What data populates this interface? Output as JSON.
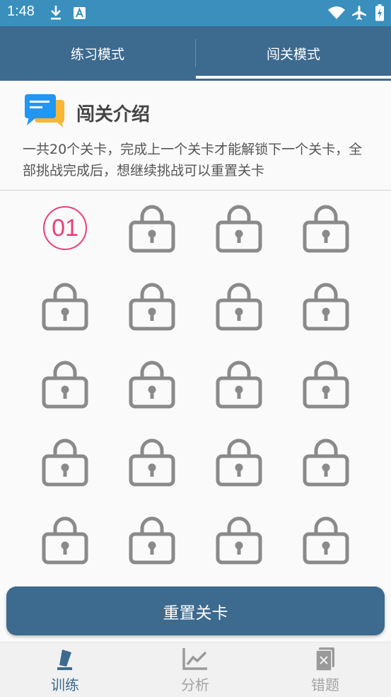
{
  "status_bar": {
    "time": "1:48"
  },
  "tabs": [
    {
      "label": "练习模式",
      "active": false
    },
    {
      "label": "闯关模式",
      "active": true
    }
  ],
  "intro": {
    "icon": "chat-bubble-icon",
    "title": "闯关介绍",
    "description": "一共20个关卡，完成上一个关卡才能解锁下一个关卡，全部挑战完成后，想继续挑战可以重置关卡"
  },
  "levels": {
    "unlocked_label": "01",
    "total": 20,
    "unlocked_count": 1,
    "locked_icon": "lock-icon"
  },
  "reset_button": {
    "label": "重置关卡"
  },
  "bottom_nav": [
    {
      "label": "训练",
      "icon": "pencil-icon",
      "active": true
    },
    {
      "label": "分析",
      "icon": "chart-icon",
      "active": false
    },
    {
      "label": "错题",
      "icon": "wrong-question-icon",
      "active": false
    }
  ],
  "colors": {
    "status_bar": "#3a8fbd",
    "primary": "#3d6a8f",
    "accent": "#ea3f78",
    "lock_gray": "#8a8a8a",
    "nav_inactive": "#a3a3a3"
  }
}
